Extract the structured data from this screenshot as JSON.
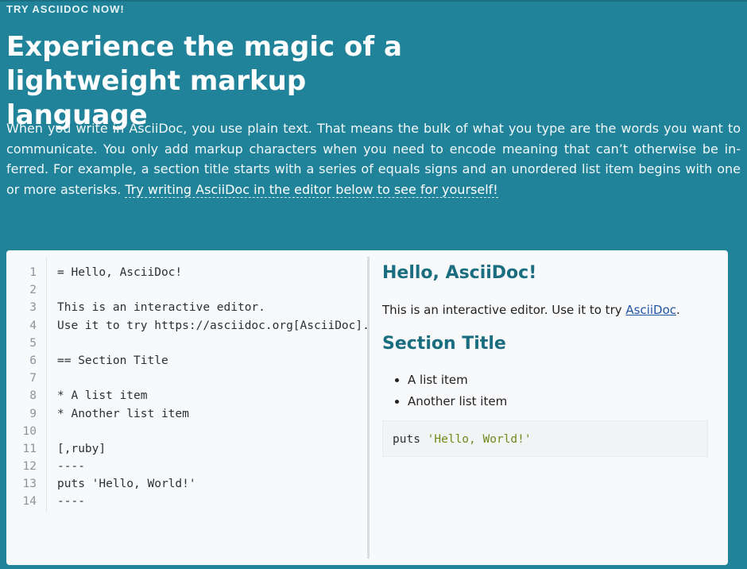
{
  "header": {
    "eyebrow": "TRY ASCIIDOC NOW!",
    "title": "Experience the magic of a lightweight markup language",
    "intro": "When you write in AsciiDoc, you use plain text. That means the bulk of what you type are the words you want to communicate. You only add markup characters when you need to encode meaning that can’t otherwise be in­ferred. For example, a section title starts with a series of equals signs and an unordered list item begins with one or more asterisks. ",
    "intro_link": "Try writing AsciiDoc in the editor below to see for yourself!"
  },
  "editor": {
    "lines": [
      {
        "no": "1",
        "text": "= Hello, AsciiDoc!"
      },
      {
        "no": "2",
        "text": ""
      },
      {
        "no": "3",
        "text": "This is an interactive editor."
      },
      {
        "no": "4",
        "text": "Use it to try https://asciidoc.org[AsciiDoc]."
      },
      {
        "no": "5",
        "text": ""
      },
      {
        "no": "6",
        "text": "== Section Title"
      },
      {
        "no": "7",
        "text": ""
      },
      {
        "no": "8",
        "text": "* A list item"
      },
      {
        "no": "9",
        "text": "* Another list item"
      },
      {
        "no": "10",
        "text": ""
      },
      {
        "no": "11",
        "text": "[,ruby]"
      },
      {
        "no": "12",
        "text": "----"
      },
      {
        "no": "13",
        "text": "puts 'Hello, World!'"
      },
      {
        "no": "14",
        "text": "----"
      }
    ]
  },
  "preview": {
    "title": "Hello, AsciiDoc!",
    "paragraph_prefix": "This is an interactive editor. Use it to try ",
    "paragraph_link": "AsciiDoc",
    "paragraph_suffix": ".",
    "section_title": "Section Title",
    "list_items": [
      "A list item",
      "Another list item"
    ],
    "code_keyword": "puts ",
    "code_string": "'Hello, World!'"
  },
  "colors": {
    "background": "#20839a",
    "heading_teal": "#1a6e80",
    "link_blue": "#2156a5",
    "code_string_green": "#708a1c"
  }
}
